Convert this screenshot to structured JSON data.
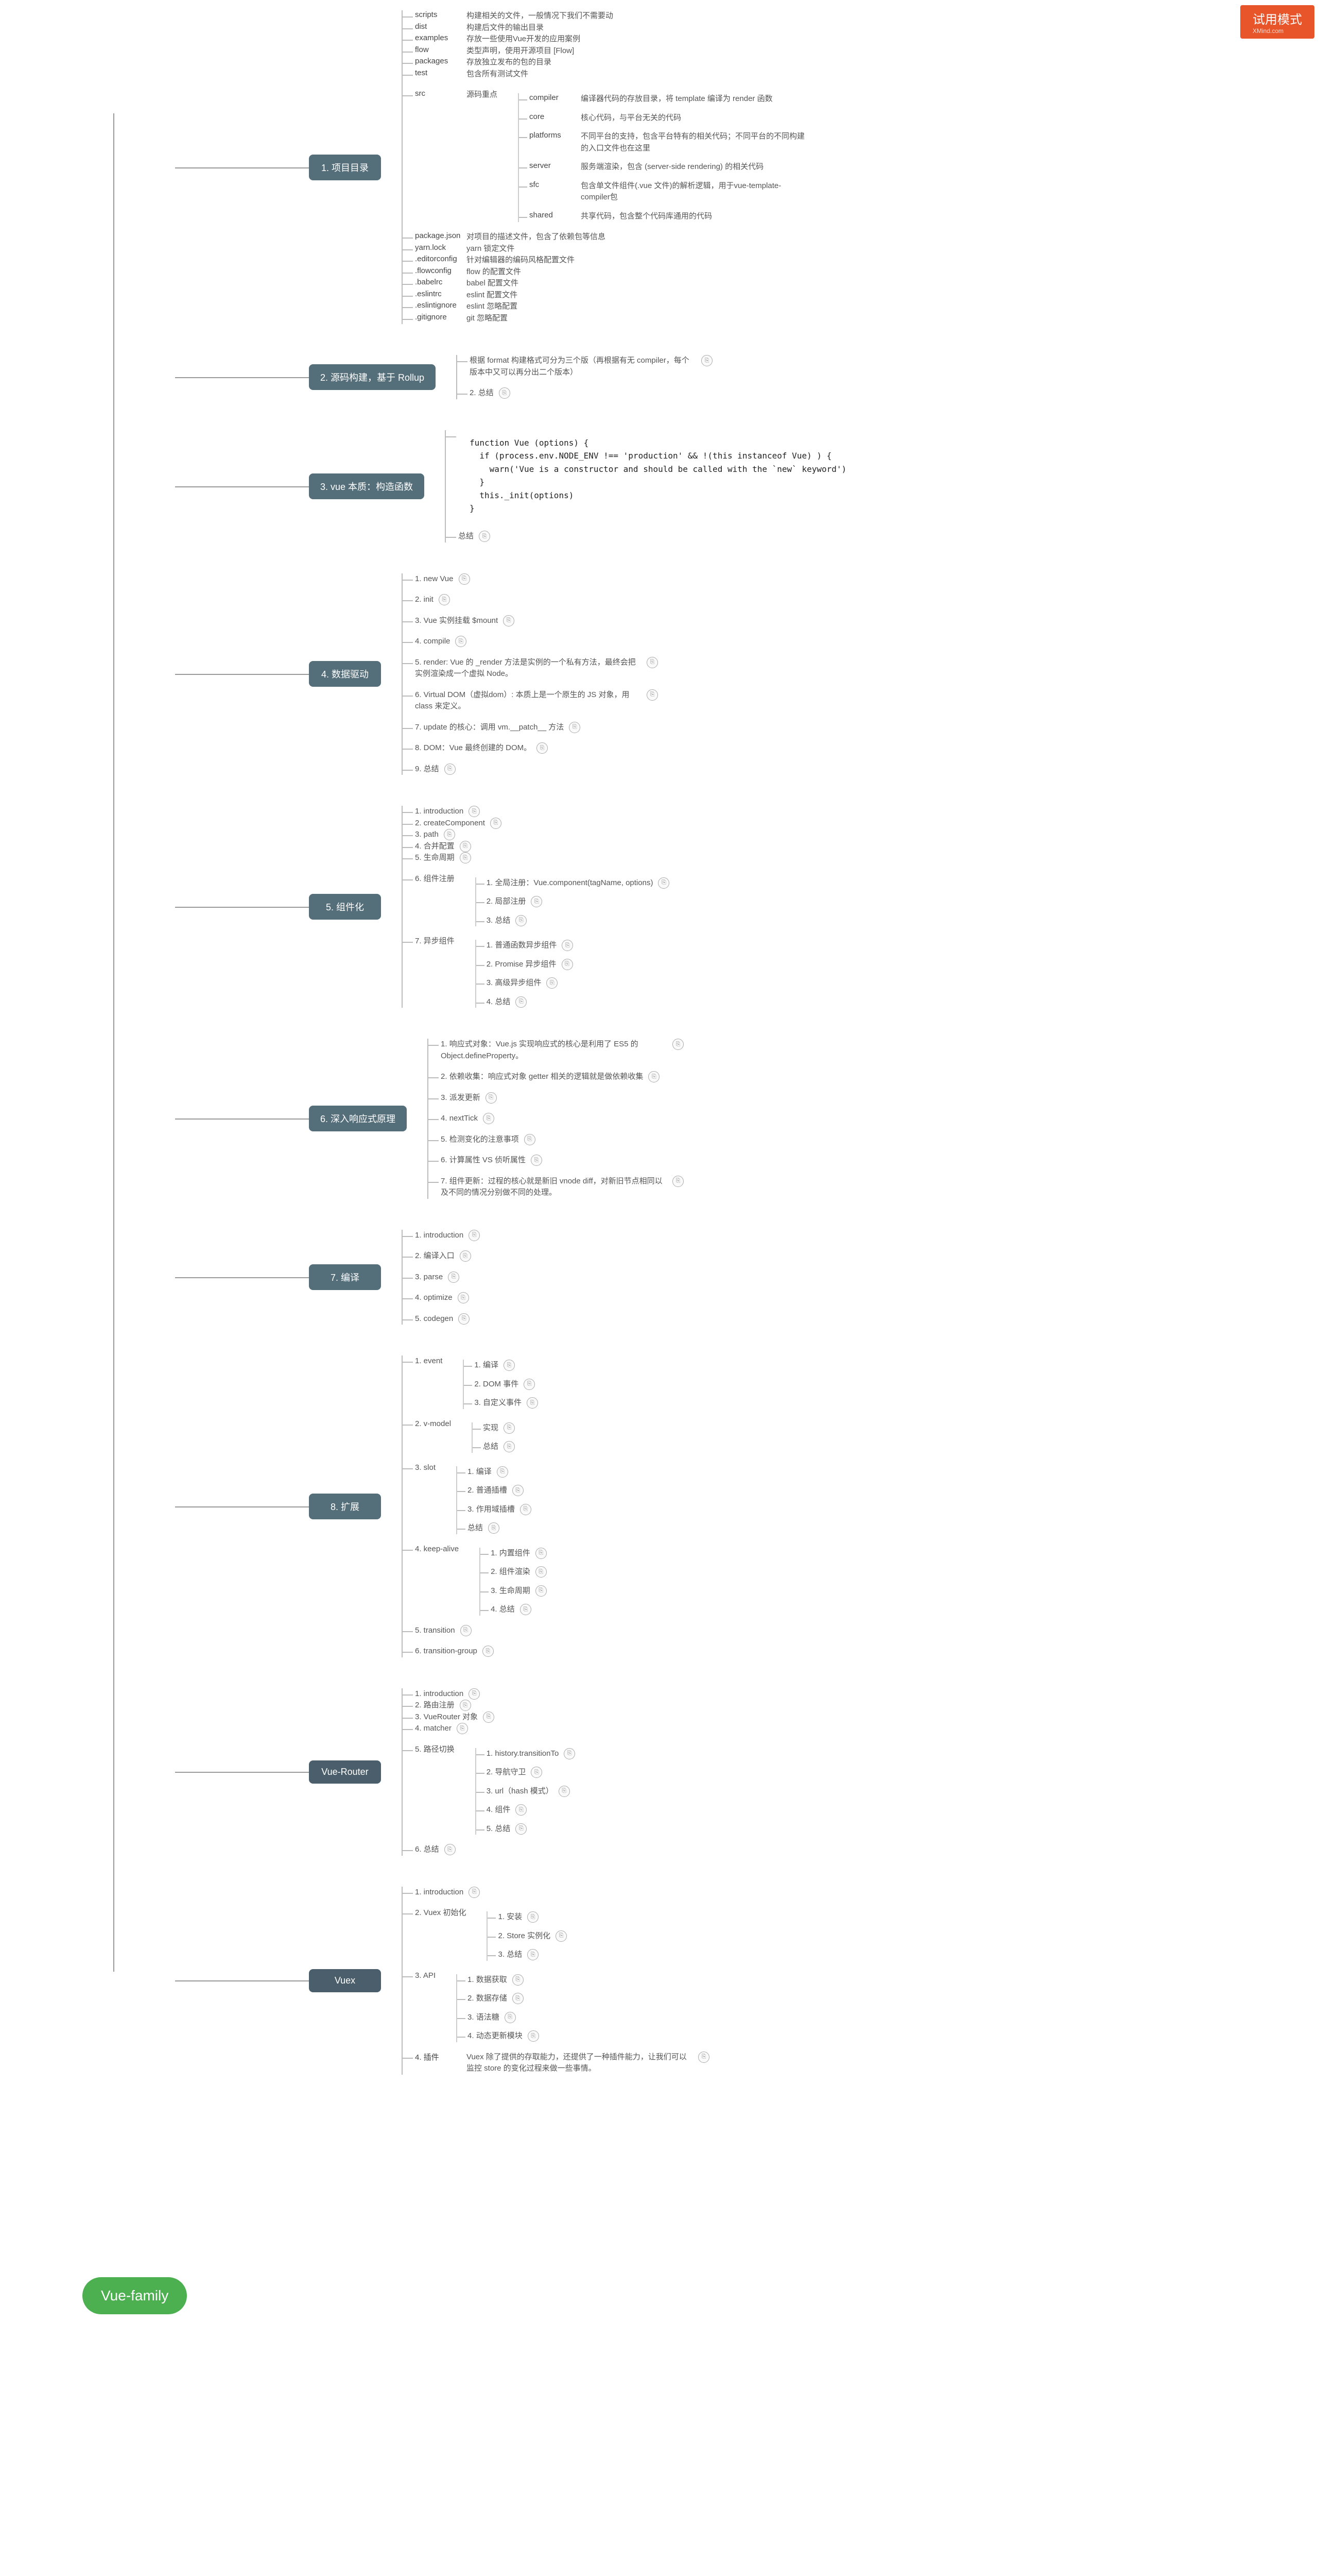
{
  "badge": {
    "title": "试用模式",
    "sub": "XMind.com"
  },
  "root": "Vue-family",
  "s1": {
    "title": "1. 项目目录",
    "items": [
      {
        "k": "scripts",
        "v": "构建相关的文件，一般情况下我们不需要动"
      },
      {
        "k": "dist",
        "v": "构建后文件的输出目录"
      },
      {
        "k": "examples",
        "v": "存放一些使用Vue开发的应用案例"
      },
      {
        "k": "flow",
        "v": "类型声明，使用开源项目 [Flow]"
      },
      {
        "k": "packages",
        "v": "存放独立发布的包的目录"
      },
      {
        "k": "test",
        "v": "包含所有测试文件"
      }
    ],
    "src_label": "src",
    "src_desc": "源码重点",
    "src_items": [
      {
        "k": "compiler",
        "v": "编译器代码的存放目录，将 template 编译为 render 函数"
      },
      {
        "k": "core",
        "v": "核心代码，与平台无关的代码"
      },
      {
        "k": "platforms",
        "v": "不同平台的支持，包含平台特有的相关代码；不同平台的不同构建的入口文件也在这里"
      },
      {
        "k": "server",
        "v": "服务端渲染，包含 (server-side rendering) 的相关代码"
      },
      {
        "k": "sfc",
        "v": "包含单文件组件(.vue 文件)的解析逻辑，用于vue-template-compiler包"
      },
      {
        "k": "shared",
        "v": "共享代码，包含整个代码库通用的代码"
      }
    ],
    "items2": [
      {
        "k": "package.json",
        "v": "对项目的描述文件，包含了依赖包等信息"
      },
      {
        "k": "yarn.lock",
        "v": "yarn 锁定文件"
      },
      {
        "k": ".editorconfig",
        "v": "针对编辑器的编码风格配置文件"
      },
      {
        "k": ".flowconfig",
        "v": "flow 的配置文件"
      },
      {
        "k": ".babelrc",
        "v": "babel 配置文件"
      },
      {
        "k": ".eslintrc",
        "v": "eslint 配置文件"
      },
      {
        "k": ".eslintignore",
        "v": "eslint 忽略配置"
      },
      {
        "k": ".gitignore",
        "v": "git 忽略配置"
      }
    ]
  },
  "s2": {
    "title": "2. 源码构建，基于 Rollup",
    "i1": "根据 format 构建格式可分为三个版（再根据有无 compiler，每个版本中又可以再分出二个版本）",
    "i2": "2. 总结"
  },
  "s3": {
    "title": "3. vue 本质：构造函数",
    "code": "function Vue (options) {\n  if (process.env.NODE_ENV !== 'production' && !(this instanceof Vue) ) {\n    warn('Vue is a constructor and should be called with the `new` keyword')\n  }\n  this._init(options)\n}",
    "i2": "总结"
  },
  "s4": {
    "title": "4. 数据驱动",
    "items": [
      "1. new Vue",
      "2. init",
      "3. Vue 实例挂载 $mount",
      "4. compile",
      "5. render: Vue 的 _render 方法是实例的一个私有方法，最终会把实例渲染成一个虚拟 Node。",
      "6. Virtual DOM（虚拟dom）: 本质上是一个原生的 JS 对象，用 class 来定义。",
      "7. update 的核心：调用 vm.__patch__ 方法",
      "8. DOM：Vue 最终创建的 DOM。",
      "9. 总结"
    ]
  },
  "s5": {
    "title": "5. 组件化",
    "items": [
      "1. introduction",
      "2. createComponent",
      "3. path",
      "4. 合并配置",
      "5. 生命周期"
    ],
    "reg": {
      "t": "6. 组件注册",
      "c": [
        "1. 全局注册：Vue.component(tagName, options)",
        "2. 局部注册",
        "3. 总结"
      ]
    },
    "async": {
      "t": "7. 异步组件",
      "c": [
        "1. 普通函数异步组件",
        "2. Promise 异步组件",
        "3. 高级异步组件",
        "4. 总结"
      ]
    }
  },
  "s6": {
    "title": "6. 深入响应式原理",
    "items": [
      "1. 响应式对象：Vue.js 实现响应式的核心是利用了 ES5 的 Object.defineProperty。",
      "2. 依赖收集：响应式对象 getter 相关的逻辑就是做依赖收集",
      "3. 派发更新",
      "4. nextTick",
      "5. 检测变化的注意事项",
      "6. 计算属性 VS 侦听属性",
      "7. 组件更新：过程的核心就是新旧 vnode diff，对新旧节点相同以及不同的情况分别做不同的处理。"
    ]
  },
  "s7": {
    "title": "7. 编译",
    "items": [
      "1. introduction",
      "2. 编译入口",
      "3. parse",
      "4. optimize",
      "5. codegen"
    ]
  },
  "s8": {
    "title": "8. 扩展",
    "event": {
      "t": "1. event",
      "c": [
        "1. 编译",
        "2. DOM 事件",
        "3. 自定义事件"
      ]
    },
    "vmodel": {
      "t": "2. v-model",
      "c": [
        "实现",
        "总结"
      ]
    },
    "slot": {
      "t": "3. slot",
      "c": [
        "1. 编译",
        "2. 普通插槽",
        "3. 作用域插槽",
        "总结"
      ]
    },
    "keep": {
      "t": "4. keep-alive",
      "c": [
        "1. 内置组件",
        "2. 组件渲染",
        "3. 生命周期",
        "4. 总结"
      ]
    },
    "i5": "5. transition",
    "i6": "6. transition-group"
  },
  "s9": {
    "title": "Vue-Router",
    "items": [
      "1. introduction",
      "2. 路由注册",
      "3. VueRouter 对象",
      "4. matcher"
    ],
    "sw": {
      "t": "5. 路径切换",
      "c": [
        "1. history.transitionTo",
        "2. 导航守卫",
        "3. url（hash 模式）",
        "4. 组件",
        "5. 总结"
      ]
    },
    "i6": "6. 总结"
  },
  "s10": {
    "title": "Vuex",
    "i1": "1. introduction",
    "init": {
      "t": "2. Vuex 初始化",
      "c": [
        "1. 安装",
        "2. Store 实例化",
        "3. 总结"
      ]
    },
    "api": {
      "t": "3. API",
      "c": [
        "1. 数据获取",
        "2. 数据存储",
        "3. 语法糖",
        "4. 动态更新模块"
      ]
    },
    "i4": {
      "t": "4. 插件",
      "v": "Vuex 除了提供的存取能力，还提供了一种插件能力，让我们可以监控 store 的变化过程来做一些事情。"
    }
  }
}
